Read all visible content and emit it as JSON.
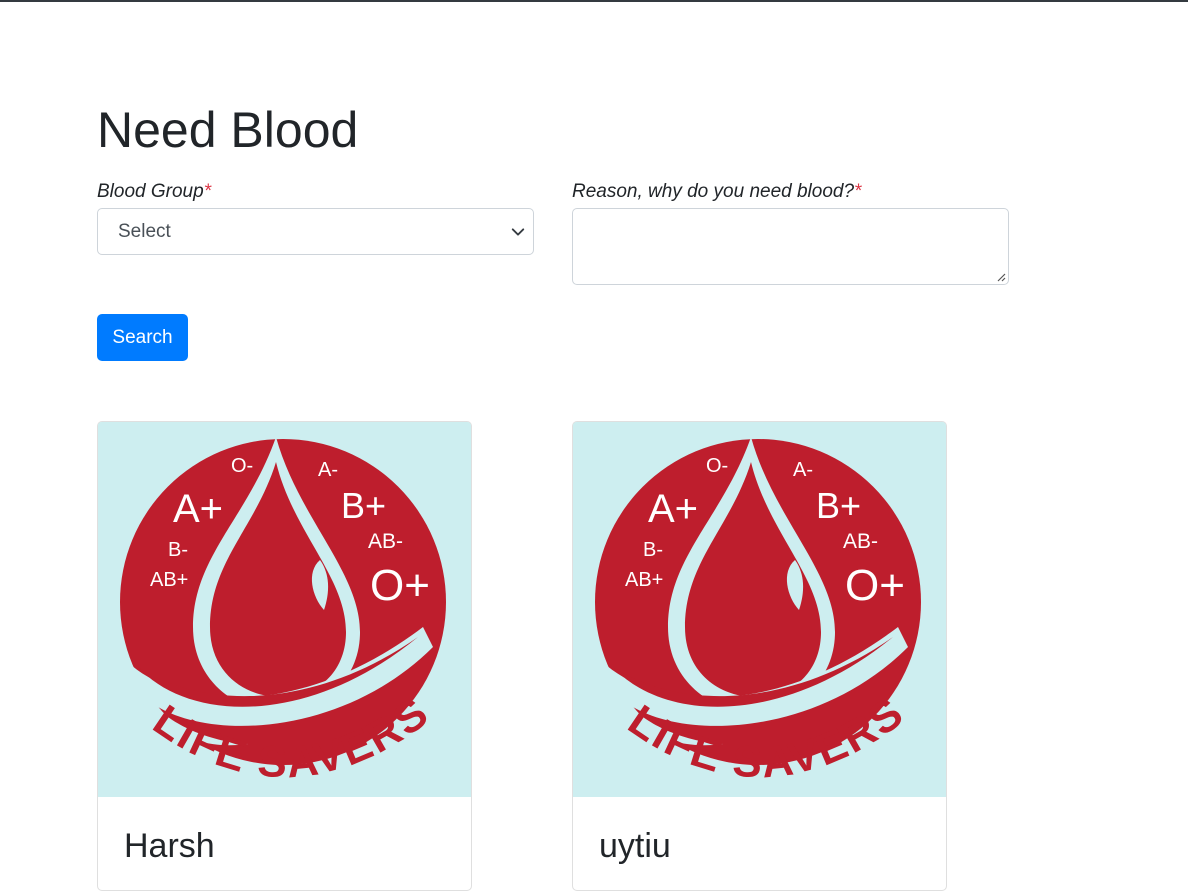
{
  "page": {
    "title": "Need Blood"
  },
  "form": {
    "blood_group": {
      "label": "Blood Group",
      "required_mark": "*",
      "selected": "Select"
    },
    "reason": {
      "label": "Reason, why do you need blood?",
      "required_mark": "*",
      "value": ""
    },
    "search_label": "Search"
  },
  "logo": {
    "text": "LIFE SAVERS",
    "blood_types": [
      "O-",
      "A-",
      "A+",
      "B+",
      "B-",
      "AB-",
      "AB+",
      "O+"
    ],
    "colors": {
      "red": "#be1e2d",
      "background": "#cdeef0"
    }
  },
  "donors": [
    {
      "name": "Harsh"
    },
    {
      "name": "uytiu"
    }
  ],
  "colors": {
    "primary": "#007bff",
    "required": "#dc3545",
    "text": "#212529"
  }
}
